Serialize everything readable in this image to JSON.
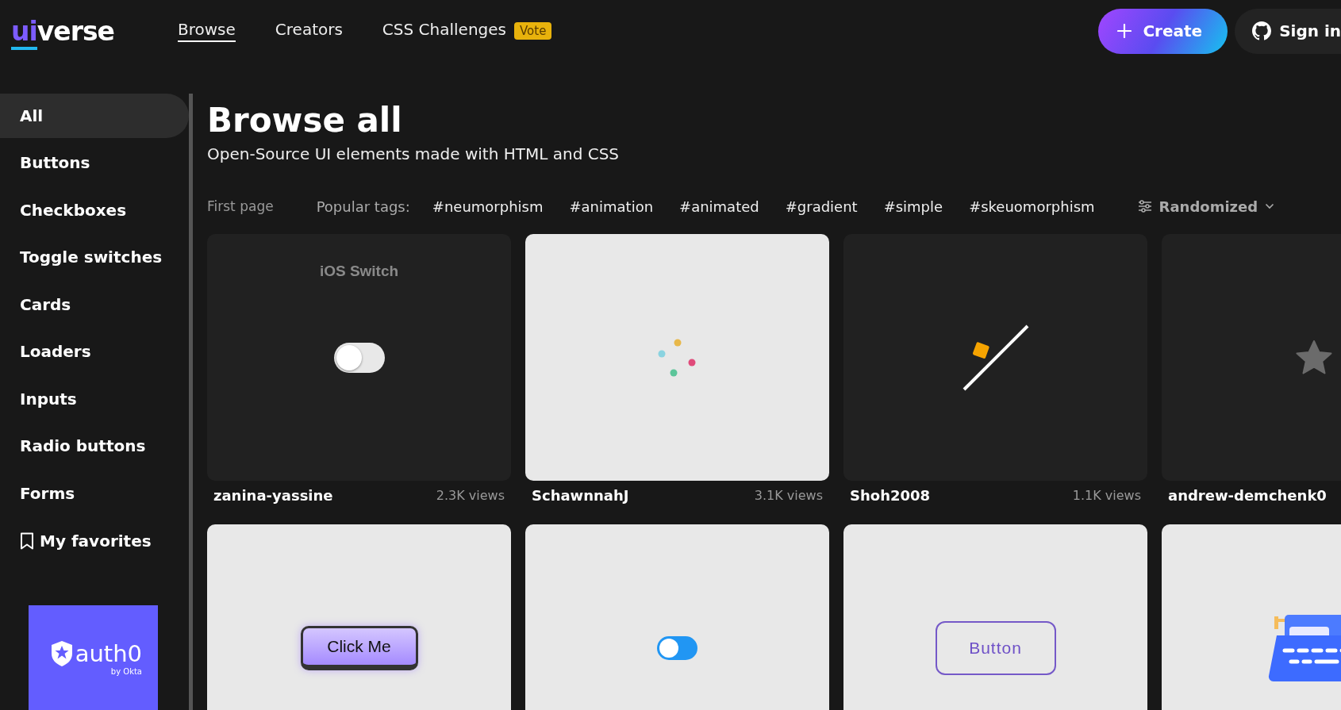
{
  "logo": {
    "accent": "ui",
    "rest": "verse"
  },
  "nav": [
    {
      "label": "Browse",
      "selected": true
    },
    {
      "label": "Creators",
      "selected": false
    },
    {
      "label": "CSS Challenges",
      "selected": false,
      "badge": "Vote"
    }
  ],
  "header_buttons": {
    "create": "Create",
    "sign_in": "Sign in"
  },
  "sidebar": {
    "items": [
      {
        "label": "All",
        "selected": true,
        "kind": "category"
      },
      {
        "label": "Buttons",
        "selected": false,
        "kind": "category"
      },
      {
        "label": "Checkboxes",
        "selected": false,
        "kind": "category"
      },
      {
        "label": "Toggle switches",
        "selected": false,
        "kind": "category"
      },
      {
        "label": "Cards",
        "selected": false,
        "kind": "category"
      },
      {
        "label": "Loaders",
        "selected": false,
        "kind": "category"
      },
      {
        "label": "Inputs",
        "selected": false,
        "kind": "category"
      },
      {
        "label": "Radio buttons",
        "selected": false,
        "kind": "category"
      },
      {
        "label": "Forms",
        "selected": false,
        "kind": "category"
      },
      {
        "label": "My favorites",
        "selected": false,
        "kind": "favorites"
      }
    ],
    "ad": {
      "brand": "auth0",
      "byline": "by Okta"
    }
  },
  "page": {
    "title": "Browse all",
    "subtitle": "Open-Source UI elements made with HTML and CSS"
  },
  "filters": {
    "first_page": "First page",
    "tags_label": "Popular tags:",
    "tags": [
      "#neumorphism",
      "#animation",
      "#animated",
      "#gradient",
      "#simple",
      "#skeuomorphism"
    ],
    "sort": "Randomized"
  },
  "cards": [
    {
      "kind": "ios-switch",
      "text": "iOS Switch",
      "on": false,
      "author": "zanina-yassine",
      "views": "2.3K views"
    },
    {
      "kind": "dots",
      "author": "SchawnnahJ",
      "views": "3.1K views"
    },
    {
      "kind": "slash",
      "author": "Shoh2008",
      "views": "1.1K views"
    },
    {
      "kind": "star",
      "author": "andrew-demchenk0"
    },
    {
      "kind": "click-button",
      "text": "Click Me"
    },
    {
      "kind": "toggle",
      "on": false
    },
    {
      "kind": "outline-button",
      "text": "Button"
    },
    {
      "kind": "typewriter"
    }
  ]
}
